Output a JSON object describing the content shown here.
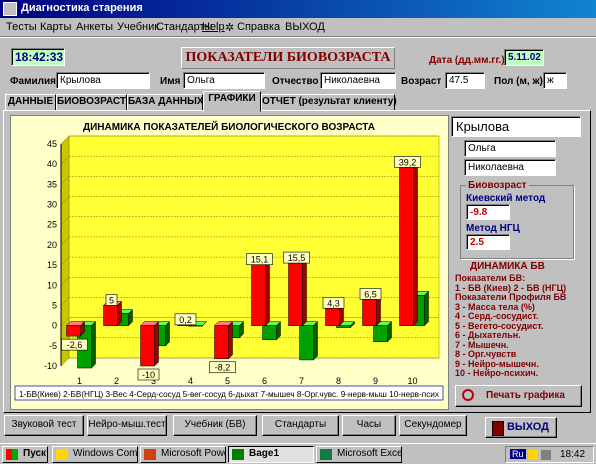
{
  "window": {
    "title": "Диагностика старения"
  },
  "menu": [
    "Тесты",
    "Карты",
    "Анкеты",
    "Учебник",
    "Стандарты",
    "Help",
    "Справка",
    "ВЫХОД"
  ],
  "header": {
    "time": "18:42:33",
    "heading": "ПОКАЗАТЕЛИ БИОВОЗРАСТА",
    "date_label": "Дата (дд.мм.гг.)",
    "date_value": "5.11.02"
  },
  "patient": {
    "surname_label": "Фамилия",
    "surname": "Крылова",
    "name_label": "Имя",
    "name": "Ольга",
    "patronymic_label": "Отчество",
    "patronymic": "Николаевна",
    "age_label": "Возраст",
    "age": "47.5",
    "sex_label": "Пол (м, ж)",
    "sex": "ж"
  },
  "tabs": [
    "ДАННЫЕ",
    "БИОВОЗРАСТ",
    "БАЗА ДАННЫХ",
    "ГРАФИКИ",
    "ОТЧЕТ (результат клиенту)"
  ],
  "active_tab": 3,
  "chart_data": {
    "type": "bar",
    "title": "ДИНАМИКА ПОКАЗАТЕЛЕЙ БИОЛОГИЧЕСКОГО ВОЗРАСТА",
    "categories": [
      "1",
      "2",
      "3",
      "4",
      "5",
      "6",
      "7",
      "8",
      "9",
      "10"
    ],
    "series": [
      {
        "color": "#ff0000",
        "values": [
          -2.6,
          5,
          -10,
          0.2,
          -8.2,
          15.1,
          15.5,
          4.3,
          6.5,
          39.2
        ]
      },
      {
        "color": "#008000",
        "values": [
          -10.5,
          3,
          -5,
          0,
          -3,
          -3.5,
          -8.5,
          -0.5,
          -4,
          7.5
        ]
      }
    ],
    "data_labels": [
      "-2,6",
      "5",
      "-10",
      "0,2",
      "-8,2",
      "15,1",
      "15,5",
      "4,3",
      "6,5",
      "39,2"
    ],
    "yticks": [
      -10,
      -5,
      0,
      5,
      10,
      15,
      20,
      25,
      30,
      35,
      40,
      45
    ],
    "ylim": [
      -10,
      45
    ],
    "grid": true,
    "legend_text": "1-БВ(Киев) 2-БВ(НГЦ) 3-Вес 4-Серд-сосуд 5-вег-сосуд 6-дыхат 7-мышеч 8-Орг.чувс. 9-нерв-мыш 10-нерв-псих"
  },
  "side": {
    "surname": "Крылова",
    "name": "Ольга",
    "patronymic": "Николаевна",
    "bio_title": "Биовозраст",
    "kiev_label": "Киевский метод",
    "kiev_value": "-9.8",
    "ngc_label": "Метод НГЦ",
    "ngc_value": "2.5",
    "dyn_title": "ДИНАМИКА БВ",
    "dyn_lines": [
      "Показатели БВ:",
      "1 - БВ (Киев)  2 - БВ (НГЦ)",
      "Показатели Профиля БВ",
      "3 - Масса тела (%)",
      "4 - Серд.-сосудист.",
      "5 - Вегето-сосудист.",
      "6 - Дыхательн.",
      "7 - Мышечн.",
      "8 - Орг.чувств",
      "9 - Нейро-мышечн.",
      "10 - Нейро-психич."
    ],
    "print_button": "Печать графика"
  },
  "bottom_buttons": [
    "Звуковой тест",
    "Нейро-мыш.тест",
    "Учебник (БВ)",
    "Стандарты",
    "Часы",
    "Секундомер"
  ],
  "exit_button": "ВЫХОД",
  "taskbar": {
    "start": "Пуск",
    "items": [
      "Windows Comm...",
      "Microsoft Power...",
      "Bage1",
      "Microsoft Excel - ..."
    ],
    "lang": "Ru",
    "clock": "18:42"
  }
}
